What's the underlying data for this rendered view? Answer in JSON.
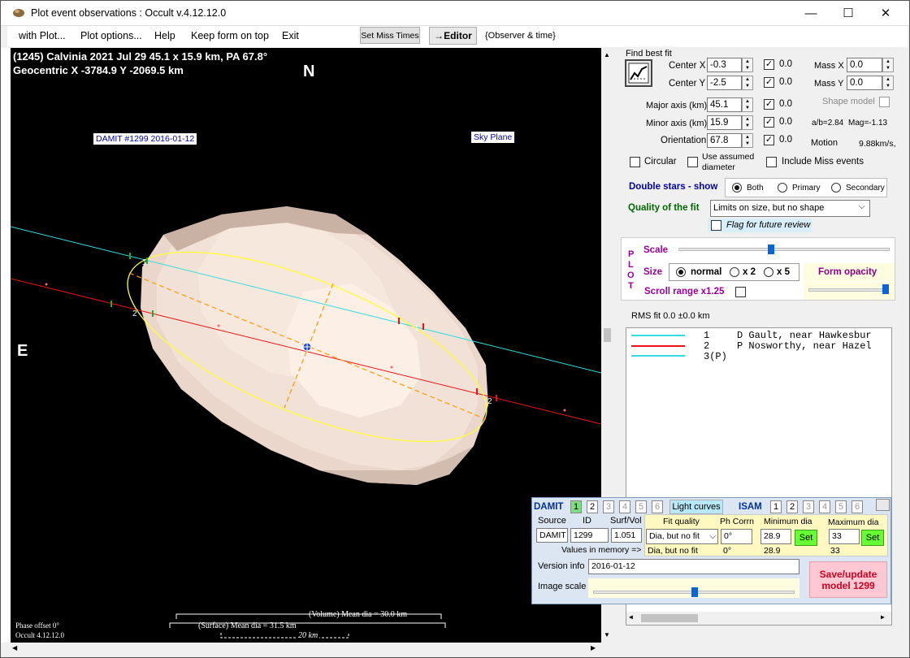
{
  "window": {
    "title": "Plot event observations : Occult v.4.12.12.0",
    "minimize": "—",
    "maximize": "☐",
    "close": "✕"
  },
  "menu": {
    "items": [
      "with Plot...",
      "Plot options...",
      "Help",
      "Keep form on top",
      "Exit"
    ],
    "set_miss_times": "Set Miss Times",
    "editor": "→Editor",
    "observer_time": "{Observer & time}"
  },
  "plot": {
    "header_line1": "(1245) Calvinia  2021 Jul 29  45.1 x 15.9 km, PA 67.8°",
    "header_line2": "Geocentric X  -3784.9  Y -2069.5 km",
    "north": "N",
    "east": "E",
    "damit_label": "DAMIT #1299 2016-01-12",
    "sky_plane_label": "Sky Plane",
    "chord1_mark": "1",
    "chord2_mark": "2",
    "chord1_end_mark": "1",
    "chord2_end_mark": "2",
    "phase_offset": "Phase offset 0°",
    "version": "Occult 4.12.12.0",
    "volume_mean_dia": "(Volume) Mean dia = 30.0 km",
    "surface_mean_dia": "(Surface) Mean dia = 31.5 km",
    "scale_bar": "20 km",
    "colors": {
      "chord1": "#33dddd",
      "chord2": "#ee1111",
      "ellipse": "#ffff33",
      "asteroid": "#f2ddd2",
      "axes": "#ff9900"
    }
  },
  "fit": {
    "heading": "Find best fit",
    "center_x_label": "Center X",
    "center_x": "-0.3",
    "center_x_chk": "0.0",
    "center_y_label": "Center Y",
    "center_y": "-2.5",
    "center_y_chk": "0.0",
    "mass_x_label": "Mass X",
    "mass_x": "0.0",
    "mass_y_label": "Mass Y",
    "mass_y": "0.0",
    "major_label": "Major axis (km)",
    "major": "45.1",
    "major_chk": "0.0",
    "minor_label": "Minor axis (km)",
    "minor": "15.9",
    "minor_chk": "0.0",
    "orient_label": "Orientation",
    "orient": "67.8",
    "orient_chk": "0.0",
    "shape_model": "Shape model",
    "ab_ratio": "a/b=2.84",
    "mag": "Mag=-1.13",
    "motion_label": "Motion",
    "motion_value": "9.88km/s,",
    "circular": "Circular",
    "use_assumed": "Use assumed",
    "diameter": "diameter",
    "include_miss": "Include Miss events",
    "double_stars": "Double stars - show",
    "both": "Both",
    "primary": "Primary",
    "secondary": "Secondary",
    "quality_label": "Quality of the fit",
    "quality_value": "Limits on size, but no shape",
    "flag_review": "Flag for future review"
  },
  "plotctl": {
    "vertical": [
      "P",
      "L",
      "O",
      "T"
    ],
    "scale": "Scale",
    "size": "Size",
    "normal": "normal",
    "x2": "x 2",
    "x5": "x 5",
    "form_opacity": "Form opacity",
    "scroll_range": "Scroll range x1.25"
  },
  "rms": "RMS fit 0.0 ±0.0 km",
  "legend": [
    {
      "num": "1",
      "text": "D Gault, near Hawkesbur",
      "color": "#33dddd"
    },
    {
      "num": "2",
      "text": "P Nosworthy, near Hazel",
      "color": "#ee1111"
    },
    {
      "num": "3(P)",
      "text": "",
      "color": "#33dddd"
    }
  ],
  "damit": {
    "title": "DAMIT",
    "tabs": [
      "1",
      "2",
      "3",
      "4",
      "5",
      "6"
    ],
    "light_curves": "Light curves",
    "isam": "ISAM",
    "isam_tabs": [
      "1",
      "2",
      "3",
      "4",
      "5",
      "6"
    ],
    "source_label": "Source",
    "source": "DAMIT",
    "id_label": "ID",
    "id": "1299",
    "surfvol_label": "Surf/Vol",
    "surfvol": "1.051",
    "fit_quality_label": "Fit quality",
    "fit_quality": "Dia, but no fit",
    "ph_corrn_label": "Ph Corrn",
    "ph_corrn": "0°",
    "min_dia_label": "Minimum dia",
    "min_dia": "28.9",
    "max_dia_label": "Maximum dia",
    "max_dia": "33",
    "set": "Set",
    "values_in_memory": "Values in memory =>",
    "mem_fit": "Dia, but no fit",
    "mem_ph": "0°",
    "mem_min": "28.9",
    "mem_max": "33",
    "version_label": "Version info",
    "version": "2016-01-12",
    "image_scale": "Image scale",
    "save_line1": "Save/update",
    "save_line2": "model 1299"
  }
}
